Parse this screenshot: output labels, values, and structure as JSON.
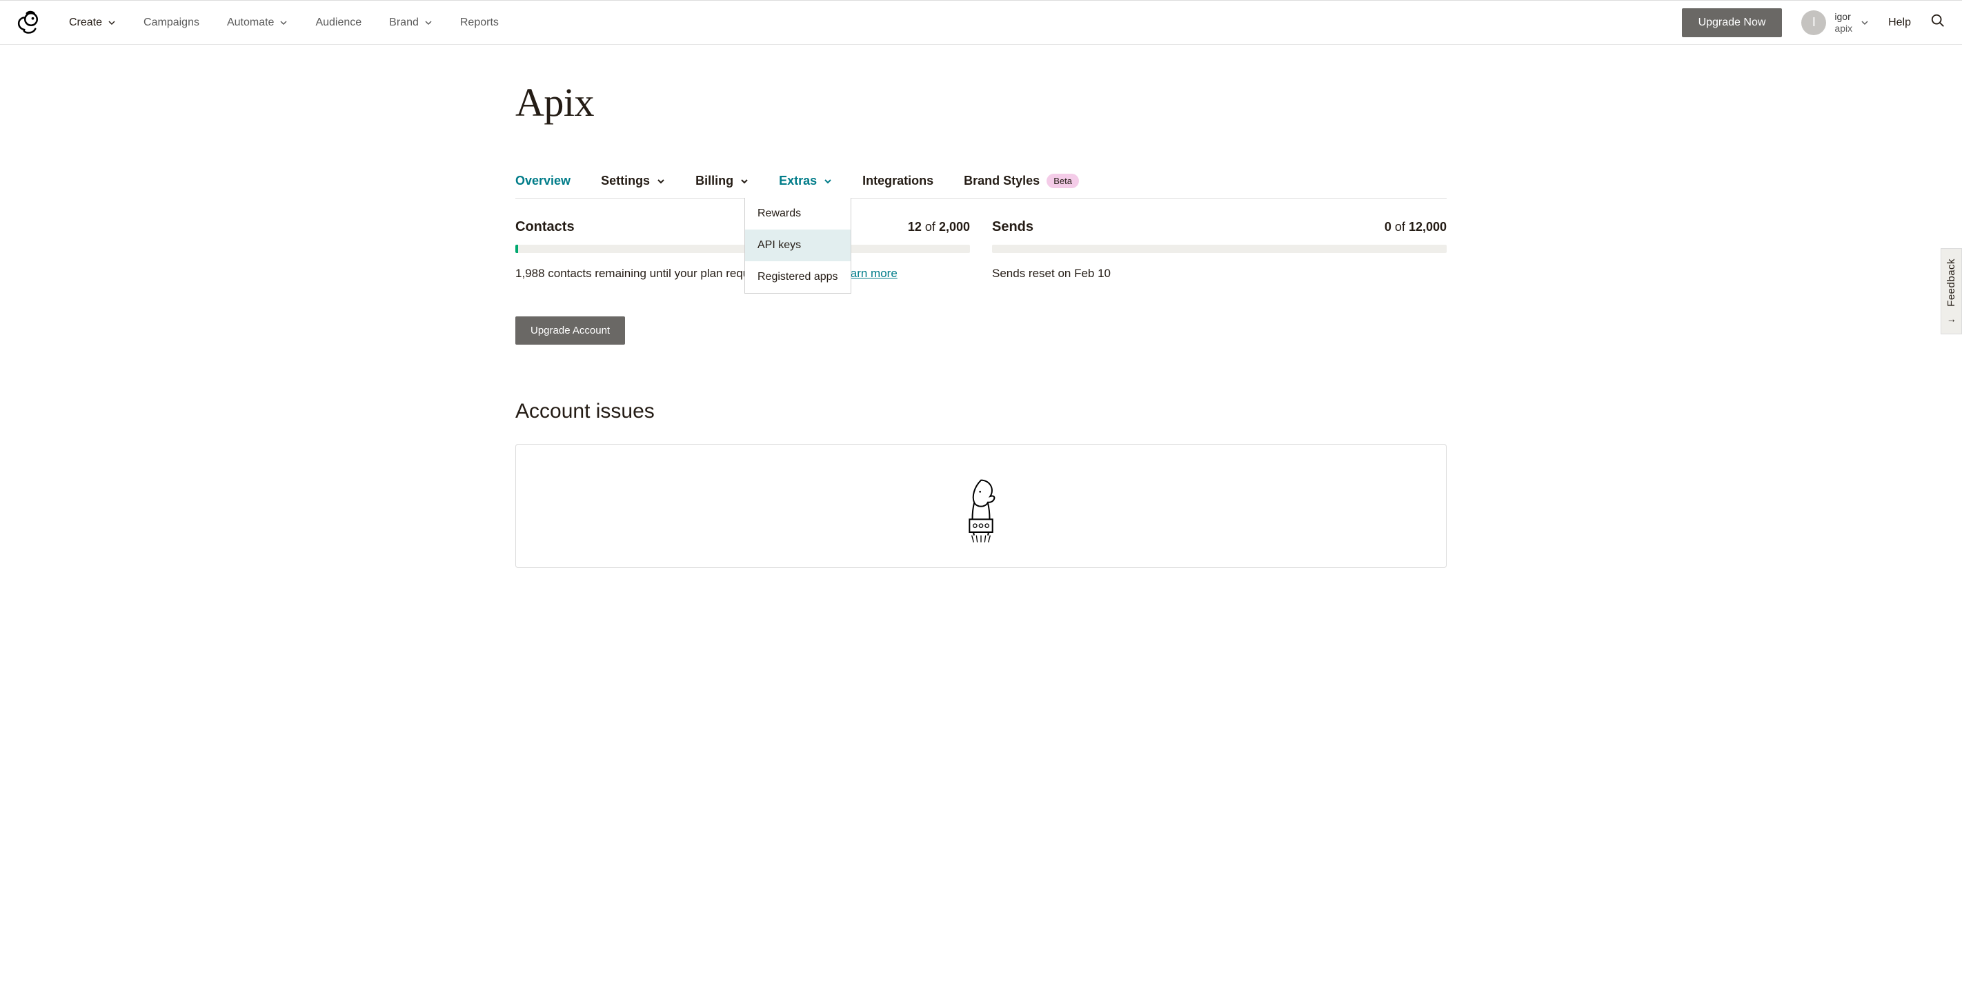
{
  "nav": {
    "create": "Create",
    "campaigns": "Campaigns",
    "automate": "Automate",
    "audience": "Audience",
    "brand": "Brand",
    "reports": "Reports",
    "upgrade": "Upgrade Now",
    "user_line1": "igor",
    "user_line2": "apix",
    "avatar_initial": "I",
    "help": "Help"
  },
  "page": {
    "title": "Apix"
  },
  "tabs": {
    "overview": "Overview",
    "settings": "Settings",
    "billing": "Billing",
    "extras": "Extras",
    "integrations": "Integrations",
    "brand_styles": "Brand Styles",
    "beta": "Beta"
  },
  "extras_menu": {
    "rewards": "Rewards",
    "api_keys": "API keys",
    "registered_apps": "Registered apps"
  },
  "contacts": {
    "label": "Contacts",
    "current": "12",
    "of": "of",
    "max": "2,000",
    "fill_pct": "0.6%",
    "remaining_text": "1,988 contacts remaining until your plan requires an upgrade.",
    "learn_more": "Learn more"
  },
  "sends": {
    "label": "Sends",
    "current": "0",
    "of": "of",
    "max": "12,000",
    "fill_pct": "0%",
    "reset_text": "Sends reset on Feb 10"
  },
  "buttons": {
    "upgrade_account": "Upgrade Account"
  },
  "sections": {
    "account_issues": "Account issues"
  },
  "feedback": {
    "label": "Feedback"
  }
}
